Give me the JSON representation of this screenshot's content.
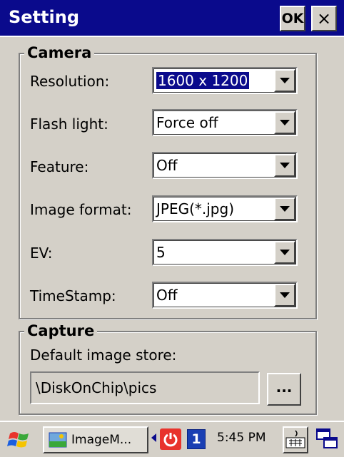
{
  "window": {
    "title": "Setting",
    "ok_label": "OK",
    "close_label": "×"
  },
  "camera": {
    "legend": "Camera",
    "fields": [
      {
        "label": "Resolution:",
        "value": "1600 x 1200"
      },
      {
        "label": "Flash light:",
        "value": "Force off"
      },
      {
        "label": "Feature:",
        "value": "Off"
      },
      {
        "label": "Image format:",
        "value": "JPEG(*.jpg)"
      },
      {
        "label": "EV:",
        "value": "5"
      },
      {
        "label": "TimeStamp:",
        "value": "Off"
      }
    ]
  },
  "capture": {
    "legend": "Capture",
    "store_label": "Default image store:",
    "store_value": "\\DiskOnChip\\pics",
    "browse_label": "..."
  },
  "taskbar": {
    "task_label": "ImageM...",
    "badge": "1",
    "clock": "5:45 PM"
  },
  "icons": {
    "start": "windows-flag-icon",
    "task": "image-app-icon",
    "power": "power-icon",
    "keyboard": "keyboard-icon",
    "windows": "overlapping-windows-icon"
  },
  "colors": {
    "titlebar": "#0a0a8c",
    "selection": "#0a0a8c",
    "face": "#d4d0c8"
  }
}
